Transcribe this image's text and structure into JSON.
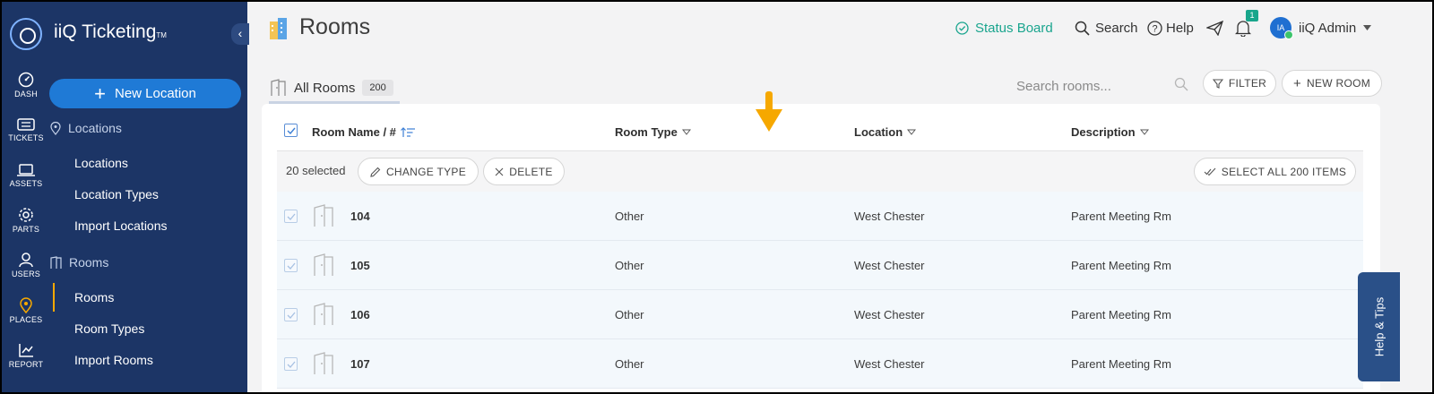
{
  "app": {
    "brand": "iiQ Ticketing",
    "brand_tm": "TM"
  },
  "rail": [
    {
      "label": "DASH",
      "icon": "dashboard-icon"
    },
    {
      "label": "TICKETS",
      "icon": "ticket-icon"
    },
    {
      "label": "ASSETS",
      "icon": "laptop-icon"
    },
    {
      "label": "PARTS",
      "icon": "gear-icon"
    },
    {
      "label": "USERS",
      "icon": "user-icon"
    },
    {
      "label": "PLACES",
      "icon": "map-pin-icon"
    },
    {
      "label": "REPORT",
      "icon": "chart-icon"
    }
  ],
  "sidebar": {
    "new_button": "New Location",
    "section_locations": "Locations",
    "locations_items": [
      "Locations",
      "Location Types",
      "Import Locations"
    ],
    "section_rooms": "Rooms",
    "rooms_items": [
      "Rooms",
      "Room Types",
      "Import Rooms"
    ]
  },
  "header": {
    "page_title": "Rooms",
    "status_board": "Status Board",
    "search": "Search",
    "help": "Help",
    "notif_count": "1",
    "avatar_initials": "IA",
    "user_name": "iiQ Admin"
  },
  "toolbar": {
    "tab_label": "All Rooms",
    "tab_count": "200",
    "search_placeholder": "Search rooms...",
    "filter": "FILTER",
    "new_room": "NEW ROOM"
  },
  "table": {
    "columns": [
      "Room Name / #",
      "Room Type",
      "Location",
      "Description"
    ],
    "selected_text": "20 selected",
    "change_type": "CHANGE TYPE",
    "delete": "DELETE",
    "select_all": "SELECT ALL 200 ITEMS",
    "rows": [
      {
        "name": "104",
        "type": "Other",
        "location": "West Chester",
        "description": "Parent Meeting Rm"
      },
      {
        "name": "105",
        "type": "Other",
        "location": "West Chester",
        "description": "Parent Meeting Rm"
      },
      {
        "name": "106",
        "type": "Other",
        "location": "West Chester",
        "description": "Parent Meeting Rm"
      },
      {
        "name": "107",
        "type": "Other",
        "location": "West Chester",
        "description": "Parent Meeting Rm"
      }
    ]
  },
  "help_tips": "Help & Tips",
  "colors": {
    "sidebar": "#1c3566",
    "primary": "#1f7ad6",
    "accent": "#f6a800",
    "status": "#1aa58e"
  }
}
